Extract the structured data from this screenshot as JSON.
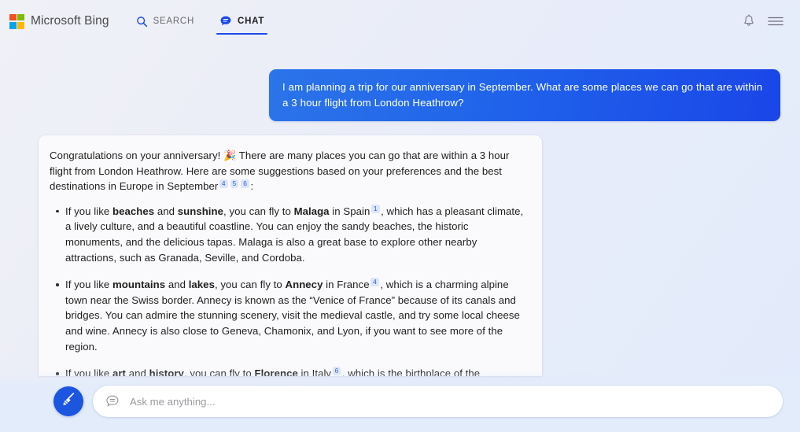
{
  "header": {
    "brand": "Microsoft Bing",
    "logo_colors": [
      "#f25022",
      "#7fba00",
      "#00a4ef",
      "#ffb900"
    ],
    "tabs": [
      {
        "label": "SEARCH",
        "icon": "search-icon",
        "active": false
      },
      {
        "label": "CHAT",
        "icon": "chat-bubble-icon",
        "active": true
      }
    ],
    "actions": [
      {
        "name": "notifications-bell-icon",
        "label": "Notifications"
      },
      {
        "name": "hamburger-menu-icon",
        "label": "Menu"
      }
    ],
    "accent_color": "#1b4ae8"
  },
  "conversation": {
    "user_message": "I am planning a trip for our anniversary in September. What are some places we can go that are within a 3 hour flight from London Heathrow?",
    "assistant": {
      "intro_part1": "Congratulations on your anniversary!",
      "intro_emoji": "🎉",
      "intro_part2": "There are many places you can go that are within a 3 hour flight from London Heathrow. Here are some suggestions based on your preferences and the best destinations in Europe in September",
      "intro_citations": [
        "4",
        "5",
        "6"
      ],
      "intro_end": ":",
      "bullets": [
        {
          "lead": "If you like ",
          "bold1": "beaches",
          "mid1": " and ",
          "bold2": "sunshine",
          "mid2": ", you can fly to ",
          "place": "Malaga",
          "after_place": " in Spain",
          "citation": "1",
          "rest": ", which has a pleasant climate, a lively culture, and a beautiful coastline. You can enjoy the sandy beaches, the historic monuments, and the delicious tapas. Malaga is also a great base to explore other nearby attractions, such as Granada, Seville, and Cordoba."
        },
        {
          "lead": "If you like ",
          "bold1": "mountains",
          "mid1": " and ",
          "bold2": "lakes",
          "mid2": ", you can fly to ",
          "place": "Annecy",
          "after_place": " in France",
          "citation": "4",
          "rest": ", which is a charming alpine town near the Swiss border. Annecy is known as the “Venice of France” because of its canals and bridges. You can admire the stunning scenery, visit the medieval castle, and try some local cheese and wine. Annecy is also close to Geneva, Chamonix, and Lyon, if you want to see more of the region."
        },
        {
          "lead": "If you like ",
          "bold1": "art",
          "mid1": " and ",
          "bold2": "history",
          "mid2": ", you can fly to ",
          "place": "Florence",
          "after_place": " in Italy",
          "citation": "6",
          "rest": ", which is the birthplace of the Renaissance and a UNESCO World Heritage Site. Florence is a treasure trove of artistic and architectural masterpieces, such as the Duomo, the Uffizi Gallery, and the Ponte Vecchio. You can also explore the Tuscan countryside, taste the famous gelato, and shop for leather goods."
        }
      ]
    }
  },
  "composer": {
    "new_topic_icon": "broom-icon",
    "new_topic_color": "#1b55e0",
    "input_icon": "chat-bubble-outline-icon",
    "placeholder": "Ask me anything...",
    "value": ""
  },
  "colors": {
    "user_bubble_from": "#2b74e9",
    "user_bubble_to": "#1a46e8",
    "citation_bg": "#dde6f8",
    "citation_fg": "#2b5fd0",
    "card_bg": "#fafafc",
    "page_bg_from": "#f0f1f7",
    "page_bg_to": "#e2ebfb"
  }
}
